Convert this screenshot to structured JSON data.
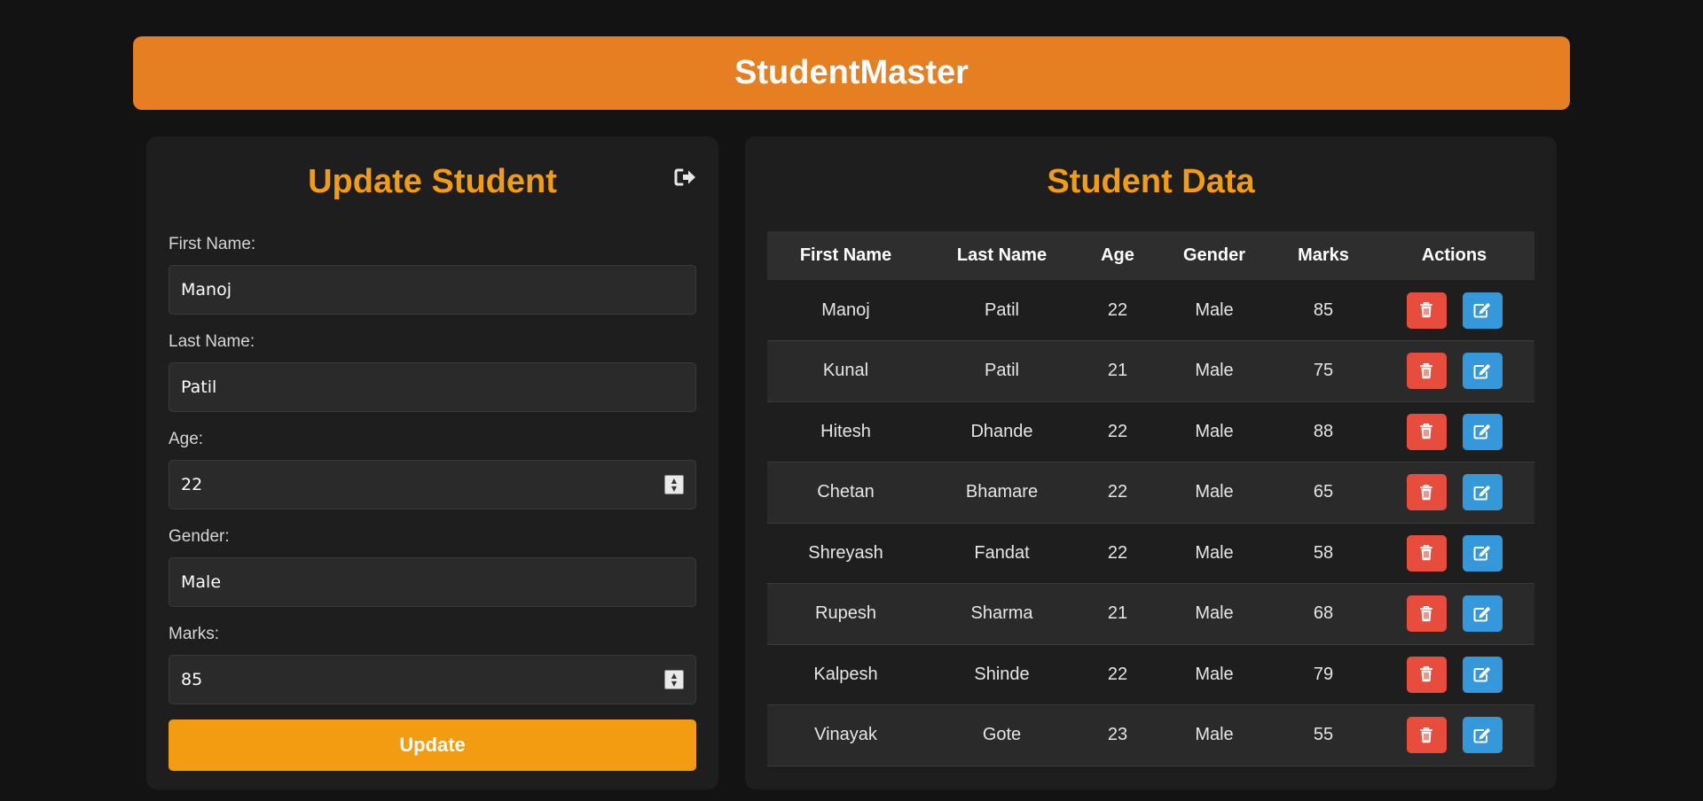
{
  "header": {
    "title": "StudentMaster"
  },
  "form": {
    "title": "Update Student",
    "fields": {
      "first_name": {
        "label": "First Name:",
        "value": "Manoj"
      },
      "last_name": {
        "label": "Last Name:",
        "value": "Patil"
      },
      "age": {
        "label": "Age:",
        "value": "22"
      },
      "gender": {
        "label": "Gender:",
        "value": "Male"
      },
      "marks": {
        "label": "Marks:",
        "value": "85"
      }
    },
    "submit_label": "Update"
  },
  "table": {
    "title": "Student Data",
    "columns": [
      "First Name",
      "Last Name",
      "Age",
      "Gender",
      "Marks",
      "Actions"
    ],
    "rows": [
      {
        "first": "Manoj",
        "last": "Patil",
        "age": "22",
        "gender": "Male",
        "marks": "85"
      },
      {
        "first": "Kunal",
        "last": "Patil",
        "age": "21",
        "gender": "Male",
        "marks": "75"
      },
      {
        "first": "Hitesh",
        "last": "Dhande",
        "age": "22",
        "gender": "Male",
        "marks": "88"
      },
      {
        "first": "Chetan",
        "last": "Bhamare",
        "age": "22",
        "gender": "Male",
        "marks": "65"
      },
      {
        "first": "Shreyash",
        "last": "Fandat",
        "age": "22",
        "gender": "Male",
        "marks": "58"
      },
      {
        "first": "Rupesh",
        "last": "Sharma",
        "age": "21",
        "gender": "Male",
        "marks": "68"
      },
      {
        "first": "Kalpesh",
        "last": "Shinde",
        "age": "22",
        "gender": "Male",
        "marks": "79"
      },
      {
        "first": "Vinayak",
        "last": "Gote",
        "age": "23",
        "gender": "Male",
        "marks": "55"
      }
    ]
  },
  "icons": {
    "logout": "sign-out-icon",
    "delete": "trash-icon",
    "edit": "edit-icon"
  },
  "colors": {
    "accent": "#f39c12",
    "header": "#e67e22",
    "delete": "#e74c3c",
    "edit": "#3498db",
    "background": "#131313",
    "panel": "#1e1e1e"
  }
}
